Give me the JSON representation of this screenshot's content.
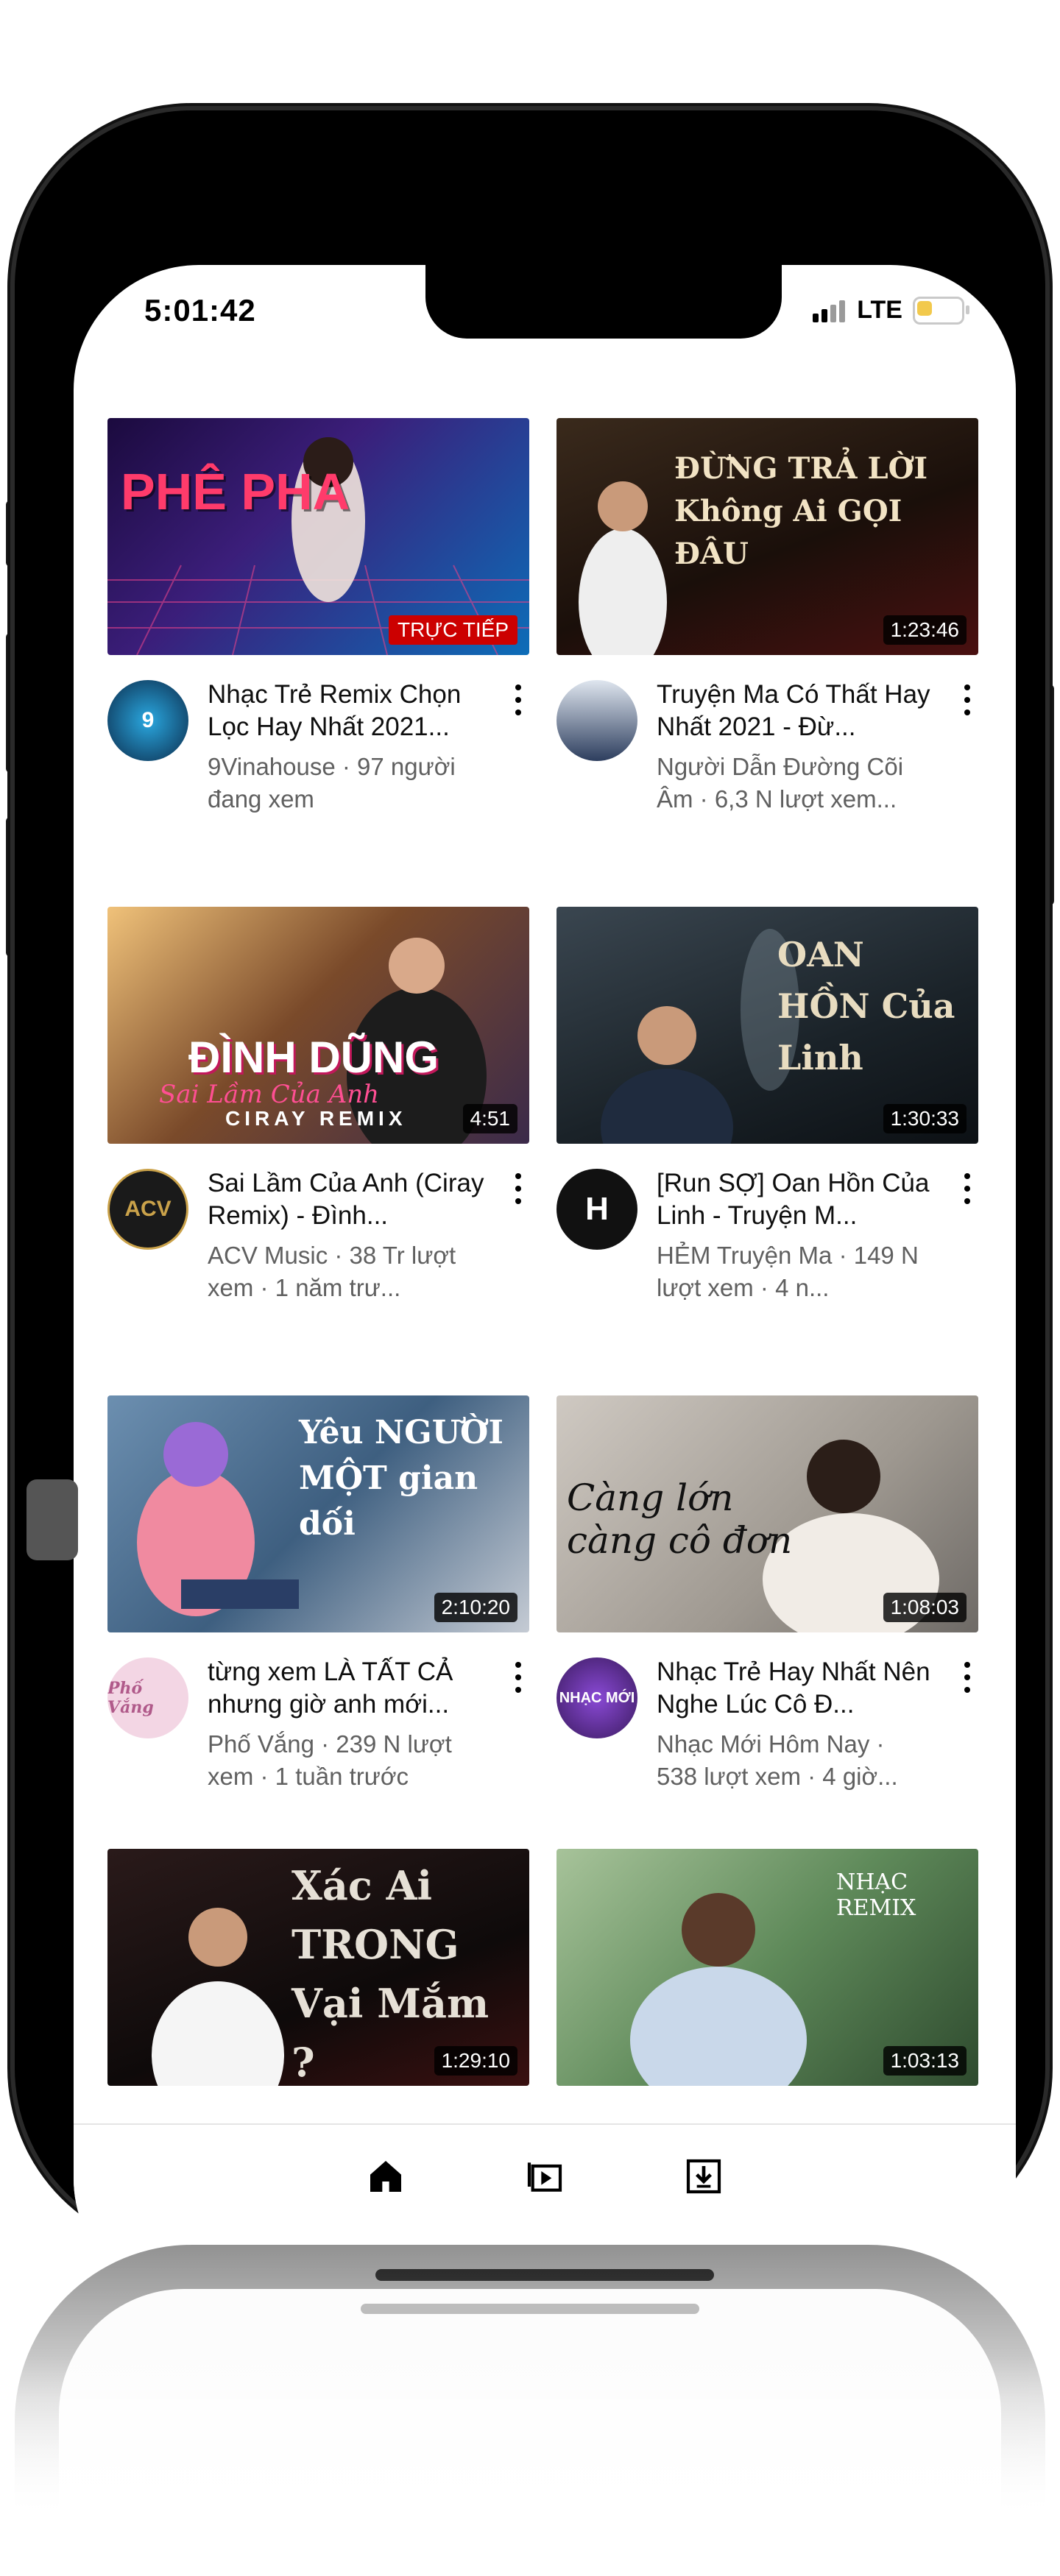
{
  "status_bar": {
    "time": "5:01:42",
    "network": "LTE",
    "battery_color": "#f2c94c"
  },
  "videos": [
    {
      "thumbnail_text": "PHÊ PHA",
      "badge": "TRỰC TIẾP",
      "badge_type": "live",
      "title": "Nhạc Trẻ Remix Chọn Lọc Hay Nhất 2021...",
      "subtitle": "9Vinahouse · 97 người đang xem",
      "avatar_label": "9",
      "avatar_color": "#0b2a4a"
    },
    {
      "thumbnail_text": "ĐỪNG TRẢ LỜI Không Ai GỌI ĐÂU",
      "badge": "1:23:46",
      "badge_type": "duration",
      "title": "Truyện Ma Có Thất Hay Nhất 2021 - Đừ...",
      "subtitle": "Người Dẫn Đường Cõi Âm · 6,3 N lượt xem...",
      "avatar_label": "",
      "avatar_color": "#2d3e5e"
    },
    {
      "thumbnail_text": "ĐÌNH DŨNG",
      "thumbnail_sub": "Sai Lầm Của Anh",
      "thumbnail_tag": "CIRAY REMIX",
      "badge": "4:51",
      "badge_type": "duration",
      "title": "Sai Lầm Của Anh (Ciray Remix) - Đình...",
      "subtitle": "ACV Music · 38 Tr lượt xem · 1 năm trư...",
      "avatar_label": "ACV",
      "avatar_color": "#1a1a1a"
    },
    {
      "thumbnail_text": "OAN HỒN Của Linh",
      "badge": "1:30:33",
      "badge_type": "duration",
      "title": "[Run SỢ] Oan Hồn Của Linh - Truyện M...",
      "subtitle": "HẺM Truyện Ma · 149 N lượt xem · 4 n...",
      "avatar_label": "H",
      "avatar_color": "#111111"
    },
    {
      "thumbnail_text": "Yêu NGƯỜI MỘT gian dối",
      "badge": "2:10:20",
      "badge_type": "duration",
      "title": "từng xem LÀ TẤT CẢ nhưng giờ anh mới...",
      "subtitle": "Phố Vắng · 239 N lượt xem · 1 tuần trước",
      "avatar_label": "Phố Vắng",
      "avatar_color": "#f3d6e4"
    },
    {
      "thumbnail_text": "Càng lớn càng cô đơn",
      "badge": "1:08:03",
      "badge_type": "duration",
      "title": "Nhạc Trẻ Hay Nhất Nên Nghe Lúc Cô Đ...",
      "subtitle": "Nhạc Mới Hôm Nay · 538 lượt xem · 4 giờ...",
      "avatar_label": "NHẠC MỚI",
      "avatar_color": "#5b2a86"
    },
    {
      "thumbnail_text": "Xác Ai TRONG Vại Mắm ?",
      "badge": "1:29:10",
      "badge_type": "duration"
    },
    {
      "thumbnail_text": "NHẠC REMIX",
      "badge": "1:03:13",
      "badge_type": "duration"
    }
  ],
  "bottom_nav": {
    "items": [
      "home-icon",
      "subscriptions-icon",
      "library-icon"
    ]
  }
}
